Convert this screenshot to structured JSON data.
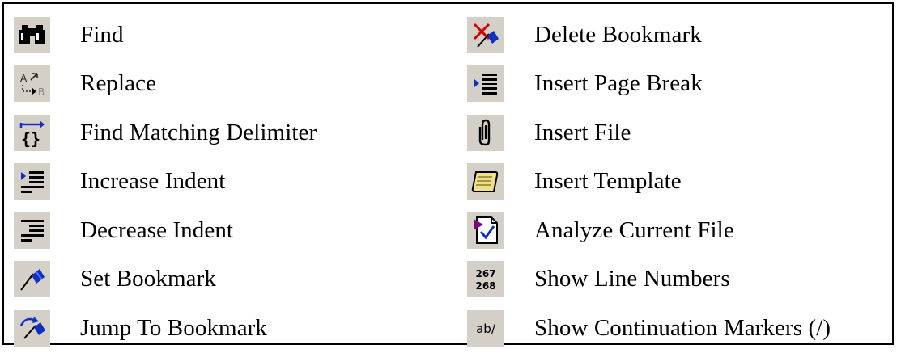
{
  "colors": {
    "icon_background": "#d4d0c8",
    "border": "#000000",
    "bookmark_blue": "#1030c0",
    "delete_red": "#d00000",
    "template_yellow": "#f2e088",
    "analyze_purple": "#800080"
  },
  "left_column": [
    {
      "icon": "binoculars-icon",
      "label": "Find"
    },
    {
      "icon": "replace-icon",
      "label": "Replace"
    },
    {
      "icon": "matching-delimiter-icon",
      "label": "Find Matching Delimiter"
    },
    {
      "icon": "increase-indent-icon",
      "label": "Increase Indent"
    },
    {
      "icon": "decrease-indent-icon",
      "label": "Decrease Indent"
    },
    {
      "icon": "set-bookmark-icon",
      "label": "Set Bookmark"
    },
    {
      "icon": "jump-to-bookmark-icon",
      "label": "Jump To Bookmark"
    }
  ],
  "right_column": [
    {
      "icon": "delete-bookmark-icon",
      "label": "Delete Bookmark"
    },
    {
      "icon": "page-break-icon",
      "label": "Insert Page Break"
    },
    {
      "icon": "paperclip-icon",
      "label": "Insert File"
    },
    {
      "icon": "scroll-template-icon",
      "label": "Insert Template"
    },
    {
      "icon": "analyze-file-icon",
      "label": "Analyze Current File"
    },
    {
      "icon": "line-numbers-icon",
      "label": "Show Line Numbers",
      "icon_text": [
        "267",
        "268"
      ]
    },
    {
      "icon": "continuation-marker-icon",
      "label": "Show Continuation Markers (/)",
      "icon_text": [
        "ab/"
      ]
    }
  ],
  "icon_glyphs": {
    "replace": [
      "A",
      "B"
    ],
    "delimiter": "{}"
  }
}
